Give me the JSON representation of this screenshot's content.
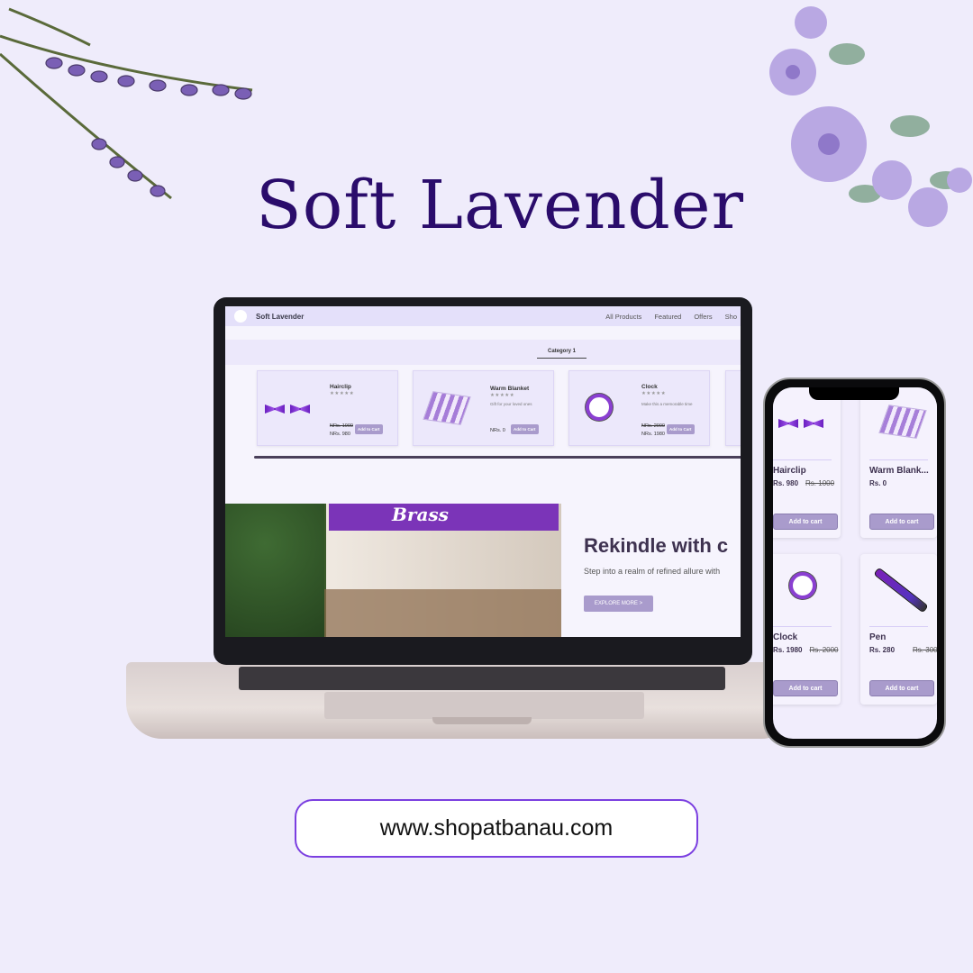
{
  "title": "Soft Lavender",
  "url": "www.shopatbanau.com",
  "laptop": {
    "brand": "Soft Lavender",
    "nav": [
      "All Products",
      "Featured",
      "Offers",
      "Sho"
    ],
    "category": "Category 1",
    "cards": [
      {
        "name": "Hairclip",
        "stars": "★★★★★",
        "desc": "",
        "old_price": "NRs. 1000",
        "price": "NRs. 980",
        "button": "Add to Cart"
      },
      {
        "name": "Warm Blanket",
        "stars": "★★★★★",
        "desc": "Gift for your loved ones",
        "old_price": "",
        "price": "NRs. 0",
        "button": "Add to Cart"
      },
      {
        "name": "Clock",
        "stars": "★★★★★",
        "desc": "Make this a memorable time",
        "old_price": "NRs. 2000",
        "price": "NRs. 1980",
        "button": "Add to Cart"
      }
    ],
    "hero": {
      "image_text": "Brass",
      "heading": "Rekindle with c",
      "text": "Step into a realm of refined allure with",
      "button": "EXPLORE MORE  >"
    }
  },
  "phone": {
    "cards": [
      {
        "name": "Hairclip",
        "price": "Rs. 980",
        "old_price": "Rs. 1000",
        "button": "Add to cart"
      },
      {
        "name": "Warm Blank...",
        "price": "Rs. 0",
        "old_price": "",
        "button": "Add to cart"
      },
      {
        "name": "Clock",
        "price": "Rs. 1980",
        "old_price": "Rs. 2000",
        "button": "Add to cart"
      },
      {
        "name": "Pen",
        "price": "Rs. 280",
        "old_price": "Rs. 300",
        "button": "Add to cart"
      }
    ]
  },
  "colors": {
    "background": "#efecfb",
    "title": "#2a0c6b",
    "accent": "#a99bcc",
    "outline": "#7b3fe0"
  }
}
